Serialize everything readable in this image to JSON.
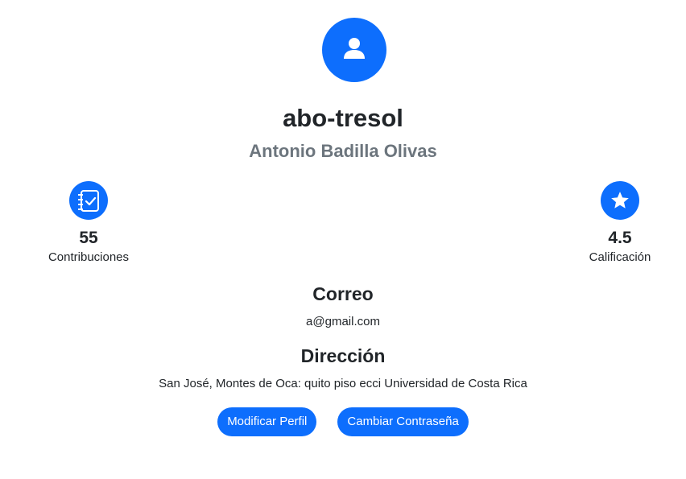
{
  "profile": {
    "username": "abo-tresol",
    "full_name": "Antonio Badilla Olivas",
    "avatar_icon": "user-icon"
  },
  "stats": {
    "contributions": {
      "icon": "checklist-notebook-icon",
      "value": "55",
      "label": "Contribuciones"
    },
    "rating": {
      "icon": "star-icon",
      "value": "4.5",
      "label": "Calificación"
    }
  },
  "email": {
    "title": "Correo",
    "value": "a@gmail.com"
  },
  "address": {
    "title": "Dirección",
    "value": "San José, Montes de Oca: quito piso ecci Universidad de Costa Rica"
  },
  "actions": {
    "edit_profile_label": "Modificar Perfil",
    "change_password_label": "Cambiar Contraseña"
  },
  "colors": {
    "accent": "#0d6efd",
    "muted_text": "#6c757d",
    "text": "#212529"
  }
}
